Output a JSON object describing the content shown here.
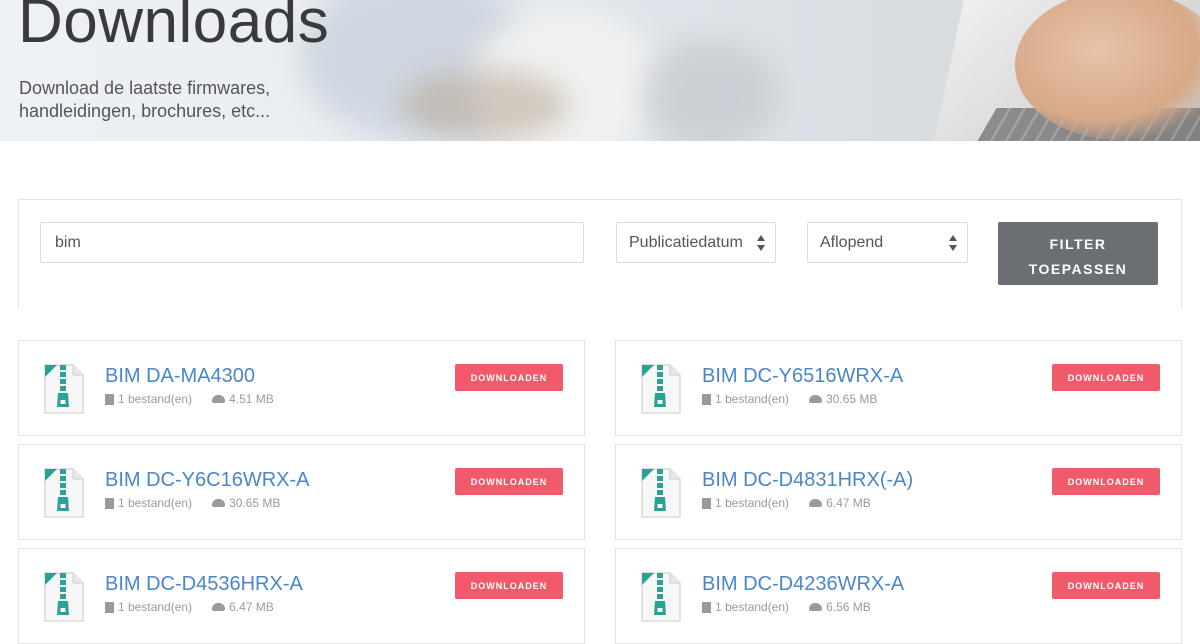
{
  "hero": {
    "title": "Downloads",
    "subtitle": "Download de laatste firmwares, handleidingen, brochures, etc..."
  },
  "filter": {
    "search_value": "bim",
    "sort_field": "Publicatiedatum",
    "sort_order": "Aflopend",
    "apply_label_line1": "FILTER",
    "apply_label_line2": "TOEPASSEN"
  },
  "results": [
    {
      "title": "BIM DA-MA4300",
      "files": "1 bestand(en)",
      "size": "4.51 MB",
      "button": "DOWNLOADEN"
    },
    {
      "title": "BIM DC-Y6516WRX-A",
      "files": "1 bestand(en)",
      "size": "30.65 MB",
      "button": "DOWNLOADEN"
    },
    {
      "title": "BIM DC-Y6C16WRX-A",
      "files": "1 bestand(en)",
      "size": "30.65 MB",
      "button": "DOWNLOADEN"
    },
    {
      "title": "BIM DC-D4831HRX(-A)",
      "files": "1 bestand(en)",
      "size": "6.47 MB",
      "button": "DOWNLOADEN"
    },
    {
      "title": "BIM DC-D4536HRX-A",
      "files": "1 bestand(en)",
      "size": "6.47 MB",
      "button": "DOWNLOADEN"
    },
    {
      "title": "BIM DC-D4236WRX-A",
      "files": "1 bestand(en)",
      "size": "6.56 MB",
      "button": "DOWNLOADEN"
    }
  ],
  "colors": {
    "link": "#4a86c8",
    "download_button": "#f05a6a",
    "filter_button": "#6b6e72",
    "file_icon_accent": "#27a398"
  },
  "icons": {
    "file": "zip-file-icon",
    "files_count": "document-icon",
    "size": "cloud-icon",
    "select": "sort-arrows-icon"
  }
}
